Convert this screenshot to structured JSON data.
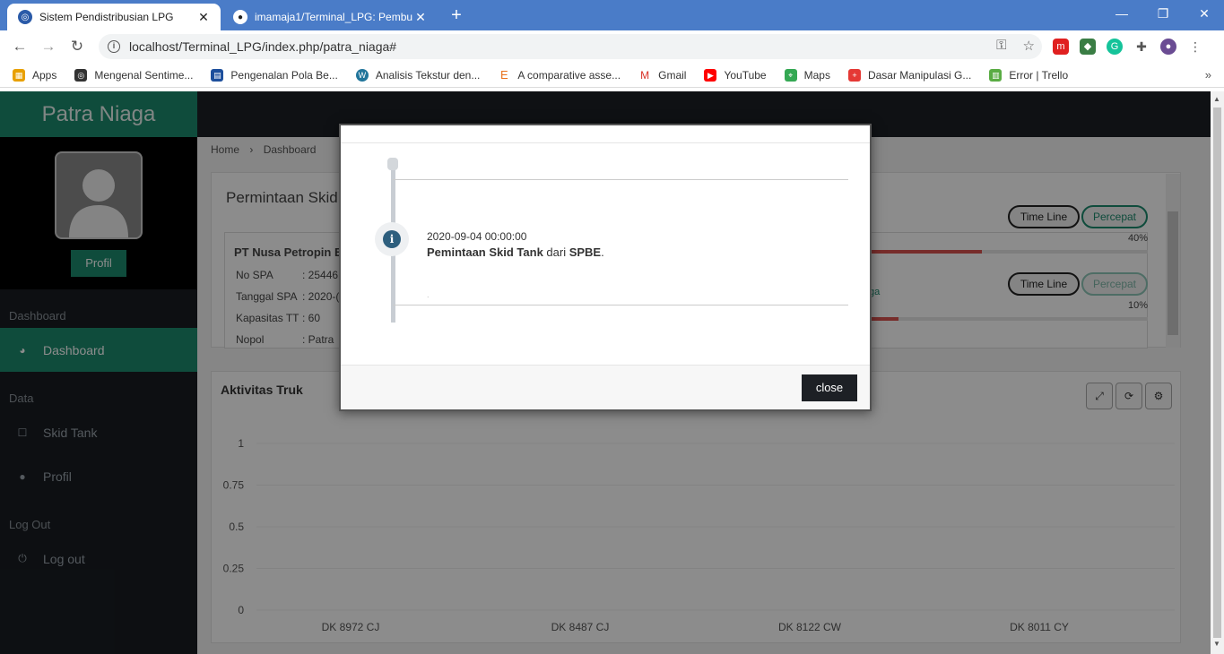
{
  "browser": {
    "tabs": [
      {
        "title": "Sistem Pendistribusian LPG",
        "close": "✕"
      },
      {
        "title": "imamaja1/Terminal_LPG: Pembua",
        "close": "✕"
      }
    ],
    "new_tab": "+",
    "window_controls": {
      "minimize": "—",
      "restore": "❐",
      "close": "✕"
    },
    "url": "localhost/Terminal_LPG/index.php/patra_niaga#",
    "bookmarks": [
      {
        "label": "Apps",
        "color": "#e8a000"
      },
      {
        "label": "Mengenal Sentime...",
        "color": "#333333"
      },
      {
        "label": "Pengenalan Pola Be...",
        "color": "#1d4f9c"
      },
      {
        "label": "Analisis Tekstur den...",
        "color": "#21759b"
      },
      {
        "label": "A comparative asse...",
        "color": "#e9711c"
      },
      {
        "label": "Gmail",
        "color": "#d93025"
      },
      {
        "label": "YouTube",
        "color": "#ff0000"
      },
      {
        "label": "Maps",
        "color": "#34a853"
      },
      {
        "label": "Dasar Manipulasi G...",
        "color": "#e53935"
      },
      {
        "label": "Error | Trello",
        "color": "#5aac44"
      }
    ],
    "bookmarks_more": "»"
  },
  "sidebar": {
    "brand": "Patra Niaga",
    "profile_button": "Profil",
    "sections": [
      {
        "heading": "Dashboard",
        "items": [
          {
            "label": "Dashboard",
            "icon": "dashboard-icon",
            "active": true
          }
        ]
      },
      {
        "heading": "Data",
        "items": [
          {
            "label": "Skid Tank",
            "icon": "square-icon"
          },
          {
            "label": "Profil",
            "icon": "user-icon"
          }
        ]
      },
      {
        "heading": "Log Out",
        "items": [
          {
            "label": "Log out",
            "icon": "power-icon"
          }
        ]
      }
    ]
  },
  "breadcrumb": {
    "home": "Home",
    "separator": "›",
    "current": "Dashboard"
  },
  "panel_requests": {
    "title": "Permintaan Skid",
    "card": {
      "company": "PT Nusa Petropin E",
      "rows": [
        {
          "key": "No SPA",
          "value": ": 25446"
        },
        {
          "key": "Tanggal SPA",
          "value": ": 2020-("
        },
        {
          "key": "Kapasitas TT",
          "value": ": 60"
        },
        {
          "key": "Nopol",
          "value": ": Patra"
        }
      ]
    },
    "items": [
      {
        "timeline_label": "Time Line",
        "accelerate_label": "Percepat",
        "progress": 40,
        "progress_label": "40%"
      },
      {
        "timeline_label": "Time Line",
        "accelerate_label": "Percepat",
        "progress": 10,
        "progress_label": "10%",
        "link_fragment": "ga"
      }
    ]
  },
  "panel_trucks": {
    "title": "Aktivitas Truk",
    "tools": {
      "expand": "⤢",
      "refresh": "⟳",
      "settings": "⚙"
    }
  },
  "chart_data": {
    "type": "bar",
    "title": "Aktivitas Truk",
    "categories": [
      "DK 8972 CJ",
      "DK 8487 CJ",
      "DK 8122 CW",
      "DK 8011 CY"
    ],
    "values": [
      0,
      0,
      0,
      0
    ],
    "ylim": [
      0,
      1
    ],
    "yticks": [
      "1",
      "0.75",
      "0.5",
      "0.25",
      "0"
    ],
    "grid": true
  },
  "modal": {
    "entry_date": "2020-09-04 00:00:00",
    "entry_msg_bold1": "Pemintaan Skid Tank",
    "entry_msg_mid": " dari ",
    "entry_msg_bold2": "SPBE",
    "entry_msg_end": ".",
    "entry_dot": ".",
    "close_label": "close",
    "icon_glyph": "i"
  }
}
